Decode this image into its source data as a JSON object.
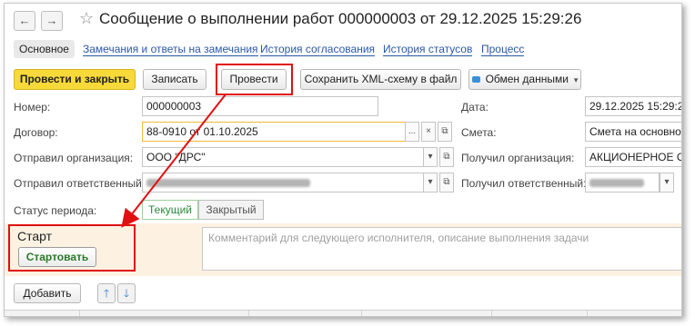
{
  "window": {
    "title": "Сообщение о выполнении работ 000000003 от 29.12.2025 15:29:26",
    "back_glyph": "←",
    "forward_glyph": "→",
    "star_glyph": "☆"
  },
  "tabs": [
    {
      "label": "Основное",
      "active": true
    },
    {
      "label": "Замечания и ответы на замечания"
    },
    {
      "label": "История согласования"
    },
    {
      "label": "История статусов"
    },
    {
      "label": "Процесс"
    }
  ],
  "toolbar": {
    "post_close_label": "Провести и закрыть",
    "write_label": "Записать",
    "post_label": "Провести",
    "save_xml_label": "Сохранить XML-схему в файл",
    "exchange_label": "Обмен данными",
    "dropdown_glyph": "▾"
  },
  "form": {
    "number_label": "Номер:",
    "number_value": "000000003",
    "date_label": "Дата:",
    "date_value": "29.12.2025 15:29:26",
    "contract_label": "Договор:",
    "contract_value": "88-0910 от 01.10.2025",
    "estimate_label": "Смета:",
    "estimate_value": "Смета на основной р",
    "sender_org_label": "Отправил организация:",
    "sender_org_value": "ООО \"ДРС\"",
    "recipient_org_label": "Получил организация:",
    "recipient_org_value": "АКЦИОНЕРНОЕ ОБЩ",
    "sender_resp_label": "Отправил ответственный:",
    "recipient_resp_label": "Получил ответственный:",
    "period_status_label": "Статус периода:",
    "period_current": "Текущий",
    "period_closed": "Закрытый",
    "more_glyph": "...",
    "clear_glyph": "×",
    "open_glyph": "⧉",
    "dropdown_glyph": "▾"
  },
  "start": {
    "title": "Старт",
    "button_label": "Стартовать",
    "comment_placeholder": "Комментарий для следующего исполнителя, описание выполнения задачи"
  },
  "table_toolbar": {
    "add_label": "Добавить",
    "up_glyph": "🡑",
    "down_glyph": "🡓"
  },
  "colors": {
    "annotation_red": "#e01010",
    "primary_yellow": "#f7d93a",
    "link_blue": "#2b57a8",
    "start_band": "#fdf1e1"
  }
}
